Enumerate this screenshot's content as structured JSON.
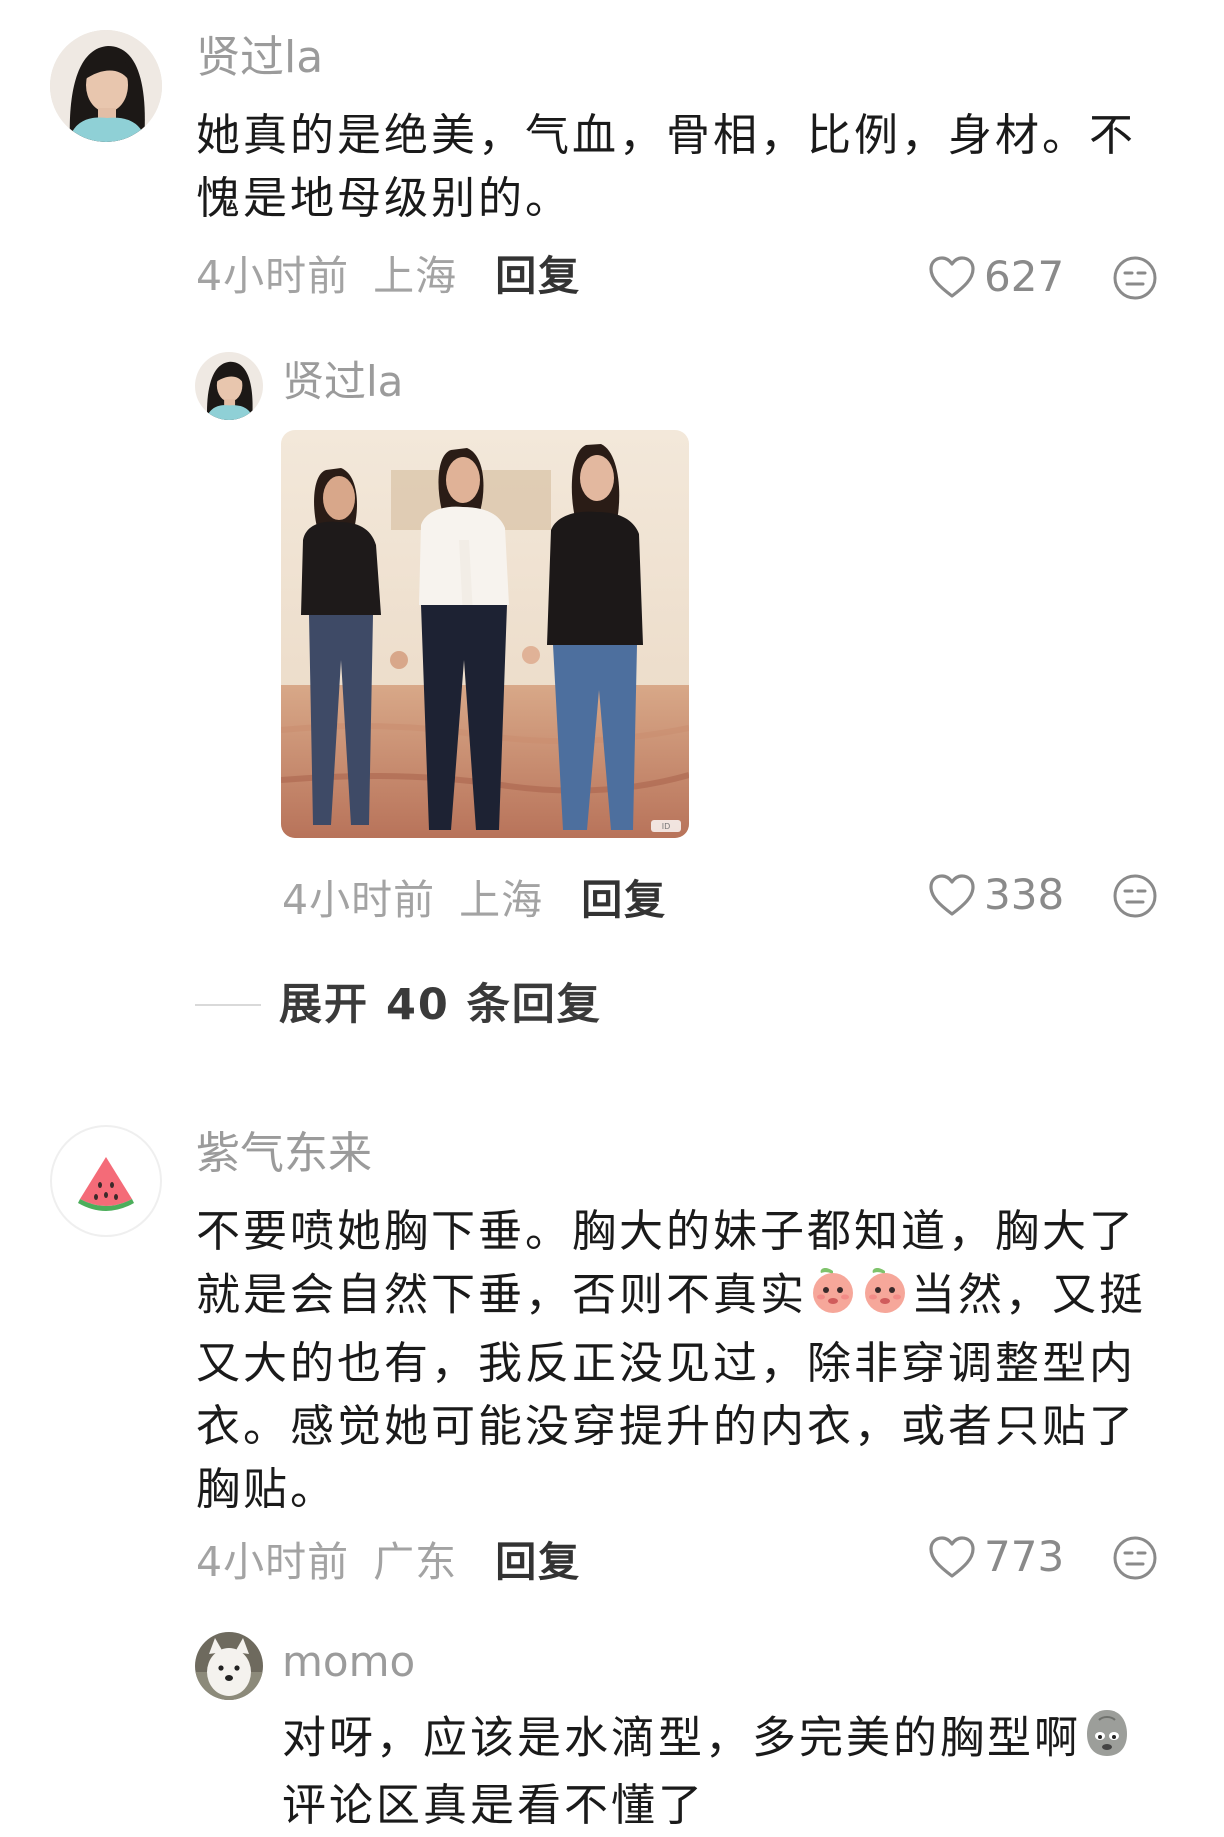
{
  "comments": [
    {
      "user": "贤过la",
      "avatar": "woman-portrait-avatar",
      "lines": [
        "她真的是绝美，气血，骨相，比例，身材。不",
        "愧是地母级别的。"
      ],
      "time": "4小时前",
      "location": "上海",
      "reply_label": "回复",
      "likes": "627",
      "reply": {
        "user": "贤过la",
        "avatar": "woman-portrait-avatar",
        "image": "photo-three-women-holding-hands",
        "image_watermark": "ID",
        "time": "4小时前",
        "location": "上海",
        "reply_label": "回复",
        "likes": "338"
      },
      "expand_label": "展开 40 条回复"
    },
    {
      "user": "紫气东来",
      "avatar": "watermelon-avatar",
      "lines": [
        "不要喷她胸下垂。胸大的妹子都知道，胸大了",
        "就是会自然下垂，否则不真实",
        "当然，又挺",
        "又大的也有，我反正没见过，除非穿调整型内",
        "衣。感觉她可能没穿提升的内衣，或者只贴了",
        "胸贴。"
      ],
      "emoji": "peach-face-emoji",
      "time": "4小时前",
      "location": "广东",
      "reply_label": "回复",
      "likes": "773",
      "reply": {
        "user": "momo",
        "avatar": "white-dog-avatar",
        "lines": [
          "对呀，应该是水滴型，多完美的胸型啊",
          "评论区真是看不懂了"
        ],
        "emoji": "grey-blob-face-emoji"
      }
    }
  ],
  "colors": {
    "username": "#9b9b9b",
    "body": "#1a1a1a",
    "meta": "#a3a3a3",
    "reply": "#333333"
  }
}
